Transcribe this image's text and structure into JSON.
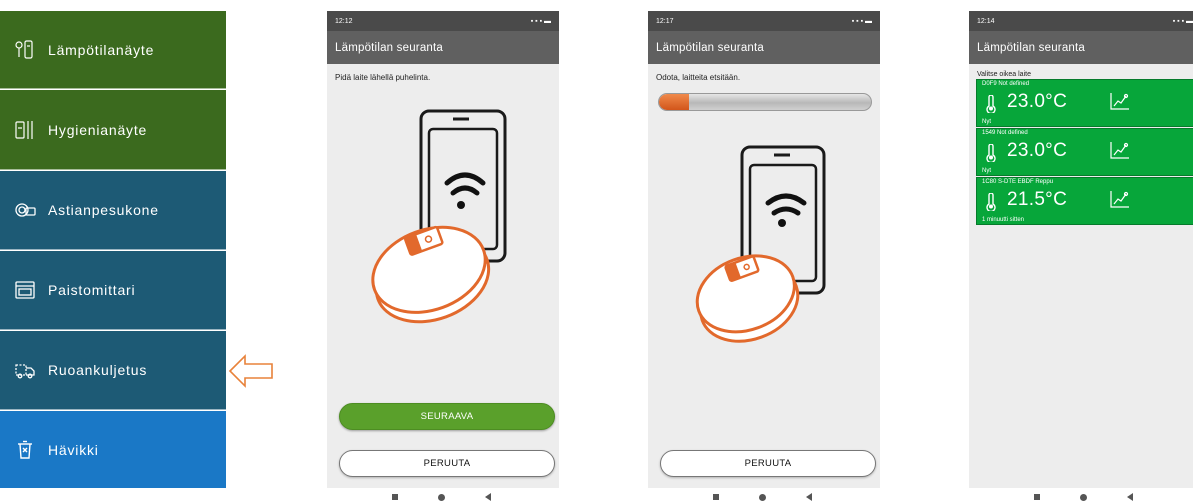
{
  "menu": {
    "items": [
      {
        "label": "Lämpötilanäyte",
        "icon": "thermometer-probe-icon"
      },
      {
        "label": "Hygienianäyte",
        "icon": "hygiene-sample-icon"
      },
      {
        "label": "Astianpesukone",
        "icon": "dishwasher-icon"
      },
      {
        "label": "Paistomittari",
        "icon": "oven-icon"
      },
      {
        "label": "Ruoankuljetus",
        "icon": "food-transport-icon"
      },
      {
        "label": "Hävikki",
        "icon": "waste-bin-icon"
      }
    ],
    "colors": {
      "green": "#3b6a1e",
      "teal": "#1d5a75",
      "blue": "#1a78c6"
    }
  },
  "pointer": {
    "icon": "arrow-left-icon",
    "color": "#e8823a"
  },
  "screens": [
    {
      "status_time": "12:12",
      "app_title": "Lämpötilan seuranta",
      "instruction": "Pidä laite lähellä puhelinta.",
      "primary_button": "SEURAAVA",
      "secondary_button": "PERUUTA"
    },
    {
      "status_time": "12:17",
      "app_title": "Lämpötilan seuranta",
      "instruction": "Odota, laitteita etsitään.",
      "progress": 0.14,
      "secondary_button": "PERUUTA"
    },
    {
      "status_time": "12:14",
      "app_title": "Lämpötilan seuranta",
      "list_title": "Valitse oikea laite",
      "devices": [
        {
          "name": "D0F9 Not defined",
          "temperature": "23.0°C",
          "time": "Nyt"
        },
        {
          "name": "1549 Not defined",
          "temperature": "23.0°C",
          "time": "Nyt"
        },
        {
          "name": "1C80 S-DTE EBDF Reppu",
          "temperature": "21.5°C",
          "time": "1 minuutti sitten"
        }
      ]
    }
  ]
}
